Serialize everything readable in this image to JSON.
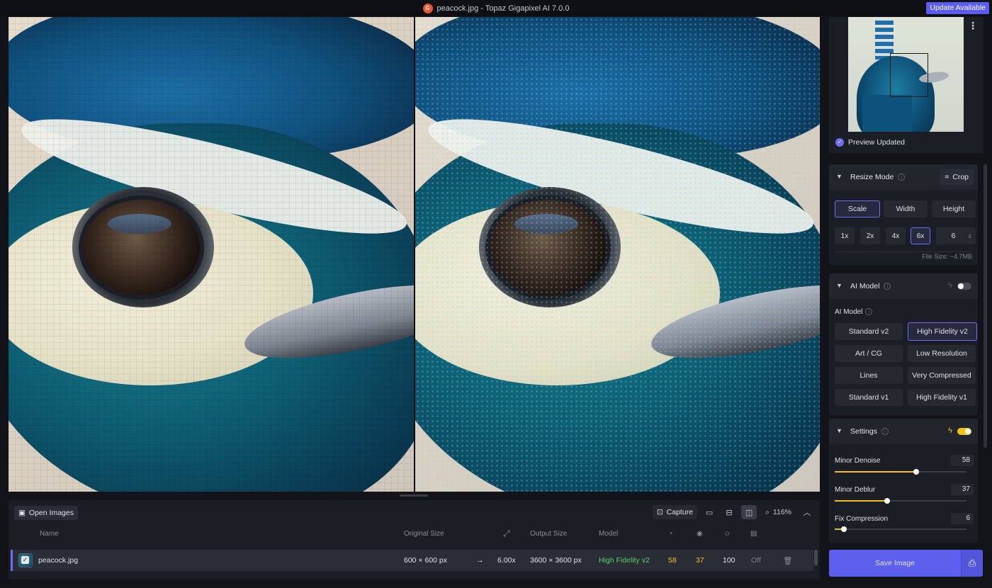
{
  "window": {
    "title": "peacock.jpg - Topaz Gigapixel AI 7.0.0",
    "update_label": "Update Available"
  },
  "bottom": {
    "open_label": "Open Images",
    "capture_label": "Capture",
    "zoom": "116%",
    "columns": {
      "name": "Name",
      "original_size": "Original Size",
      "output_size": "Output Size",
      "model": "Model"
    },
    "row": {
      "name": "peacock.jpg",
      "original_size": "600 × 600 px",
      "arrow": "→",
      "scale": "6.00x",
      "output_size": "3600 × 3600 px",
      "model": "High Fidelity v2",
      "denoise": "58",
      "deblur": "37",
      "face": "100",
      "off": "Off"
    },
    "colors": {
      "model": "#57d26a",
      "value": "#f2c21a"
    }
  },
  "preview": {
    "status": "Preview Updated"
  },
  "resize": {
    "title": "Resize Mode",
    "crop_label": "Crop",
    "modes": [
      "Scale",
      "Width",
      "Height"
    ],
    "active_mode": "Scale",
    "multipliers": [
      "1x",
      "2x",
      "4x",
      "6x"
    ],
    "active_multiplier": "6x",
    "custom_value": "6",
    "custom_unit": "x",
    "file_size": "File Size: ~4.7MB"
  },
  "ai_model": {
    "title": "AI Model",
    "subtitle": "AI Model",
    "enabled": false,
    "models": [
      "Standard v2",
      "High Fidelity v2",
      "Art / CG",
      "Low Resolution",
      "Lines",
      "Very Compressed",
      "Standard v1",
      "High Fidelity v1"
    ],
    "active_model": "High Fidelity v2"
  },
  "settings": {
    "title": "Settings",
    "enabled": true,
    "accent": "#f2c21a",
    "sliders": [
      {
        "label": "Minor Denoise",
        "value": 58,
        "fraction": 0.62
      },
      {
        "label": "Minor Deblur",
        "value": 37,
        "fraction": 0.4
      },
      {
        "label": "Fix Compression",
        "value": 6,
        "fraction": 0.07
      }
    ]
  },
  "save": {
    "label": "Save Image"
  }
}
